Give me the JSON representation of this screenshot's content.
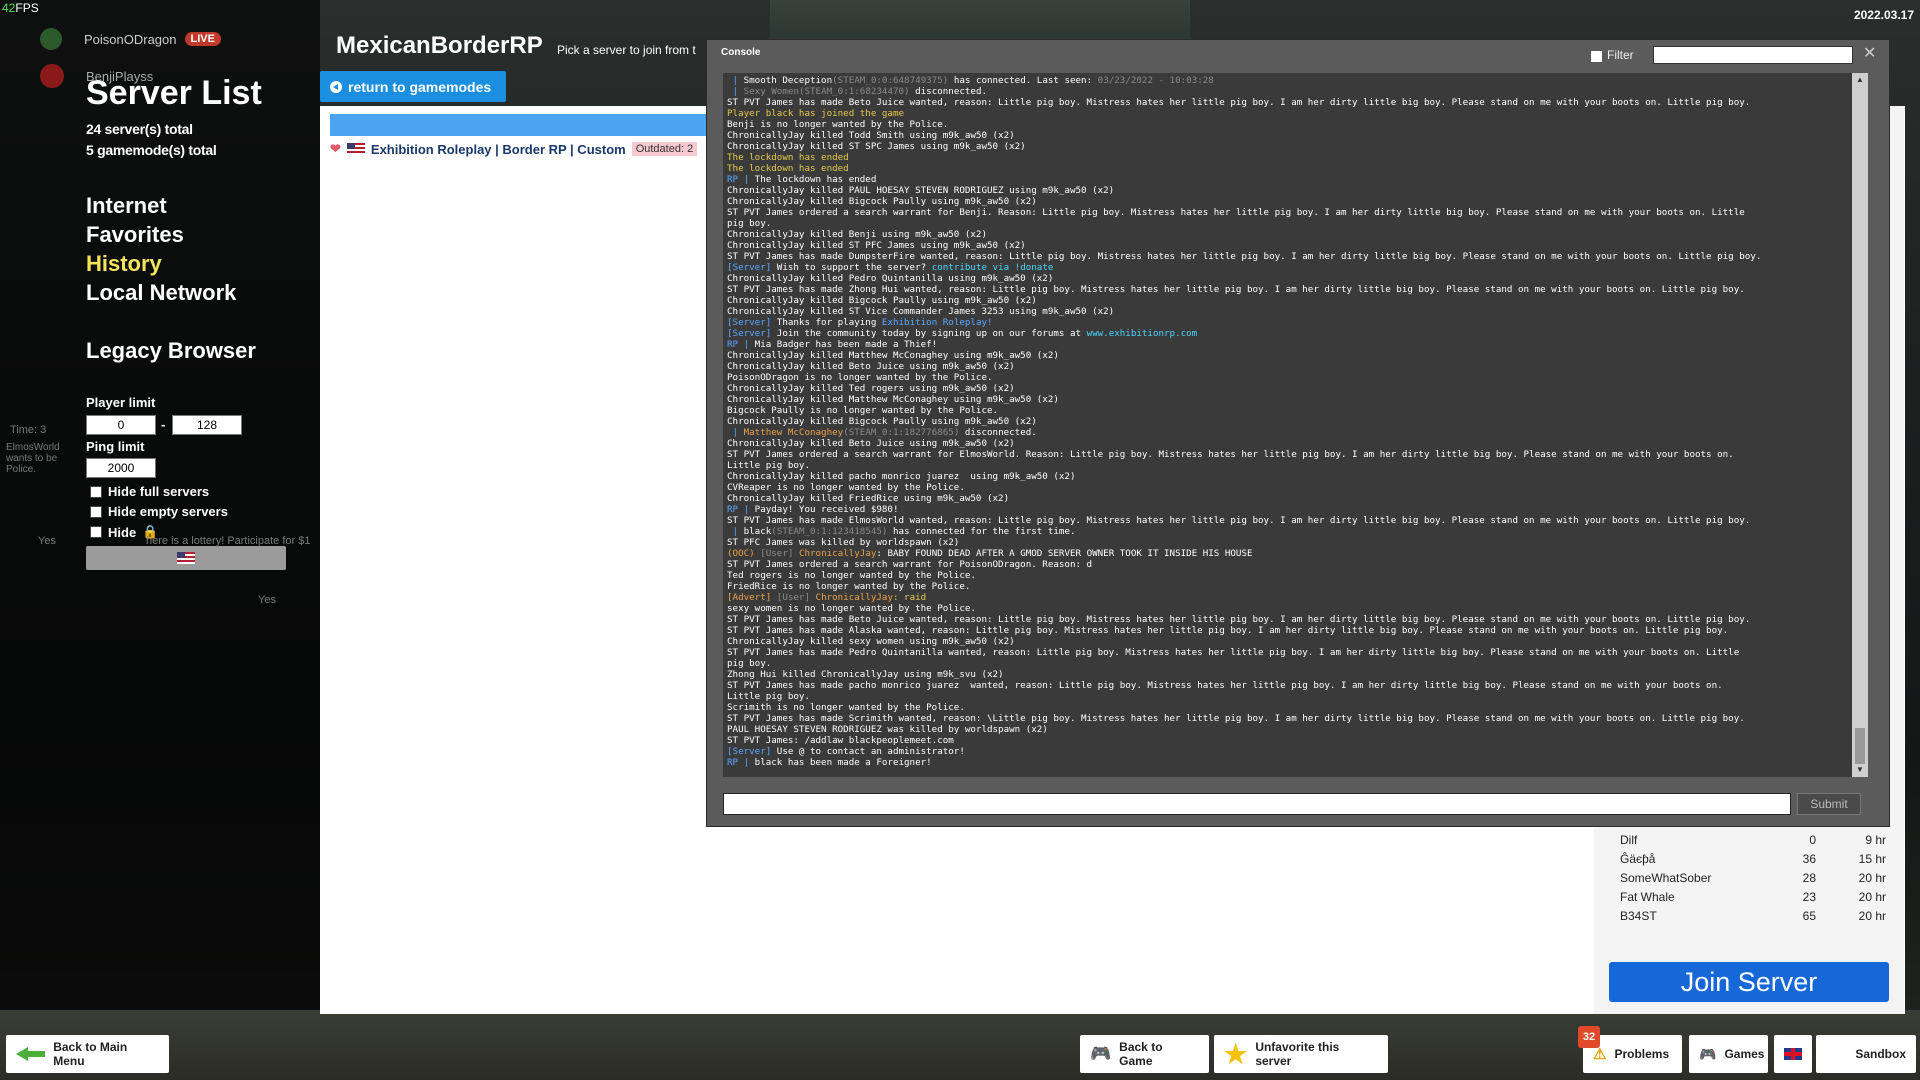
{
  "hud": {
    "fps": "42",
    "fps_unit": "FPS",
    "date": "2022.03.17"
  },
  "user": {
    "name": "PoisonODragon",
    "live": "LIVE",
    "secondary_name": "BenjiPlayss"
  },
  "sidebar": {
    "title": "Server List",
    "servers_total": "24 server(s) total",
    "gamemodes_total": "5 gamemode(s) total",
    "nav": [
      "Internet",
      "Favorites",
      "History",
      "Local Network"
    ],
    "legacy": "Legacy Browser",
    "player_limit_label": "Player limit",
    "player_min": "0",
    "player_sep": "-",
    "player_max": "128",
    "ping_limit_label": "Ping limit",
    "ping_value": "2000",
    "hide_full": "Hide full servers",
    "hide_empty": "Hide empty servers",
    "hide_locked": "Hide"
  },
  "background_text": {
    "elmos": "ElmosWorld wants to be Police.",
    "lottery": "here is a lottery! Participate for $1",
    "yes1": "Yes",
    "yes2": "Yes",
    "time": "Time: 3"
  },
  "header": {
    "gamemode": "MexicanBorderRP",
    "subtitle": "Pick a server to join from t",
    "return_label": "return to gamemodes"
  },
  "server": {
    "name": "Exhibition Roleplay | Border RP | Custom",
    "status": "Outdated: 2"
  },
  "players": [
    {
      "name": "Dilf",
      "score": "0",
      "time": "9 hr"
    },
    {
      "name": "Ĝäєƥå",
      "score": "36",
      "time": "15 hr"
    },
    {
      "name": "SomeWhatSober",
      "score": "28",
      "time": "20 hr"
    },
    {
      "name": "Fat Whale",
      "score": "23",
      "time": "20 hr"
    },
    {
      "name": "B34ST",
      "score": "65",
      "time": "20 hr"
    }
  ],
  "join_label": "Join Server",
  "console": {
    "title": "Console",
    "filter_label": "Filter",
    "submit_label": "Submit",
    "lines": [
      [
        [
          "b",
          " | "
        ],
        [
          "w",
          "Smooth Deception"
        ],
        [
          "g",
          "(STEAM_0:0:648749375)"
        ],
        [
          "w",
          " has connected. Last seen: "
        ],
        [
          "g",
          "03/23/2022 - 10:03:28"
        ]
      ],
      [
        [
          "b",
          " | "
        ],
        [
          "g",
          "Sexy Women"
        ],
        [
          "g",
          "(STEAM_0:1:68234470)"
        ],
        [
          "w",
          " disconnected."
        ]
      ],
      [
        [
          "w",
          "ST PVT James has made Beto Juice wanted, reason: Little pig boy. Mistress hates her little pig boy. I am her dirty little big boy. Please stand on me with your boots on. Little pig boy."
        ]
      ],
      [
        [
          "y",
          "Player black has joined the game"
        ]
      ],
      [
        [
          "w",
          "Benji is no longer wanted by the Police."
        ]
      ],
      [
        [
          "w",
          "ChronicallyJay killed Todd Smith using m9k_aw50 (x2)"
        ]
      ],
      [
        [
          "w",
          "ChronicallyJay killed ST SPC James using m9k_aw50 (x2)"
        ]
      ],
      [
        [
          "y",
          "The lockdown has ended"
        ]
      ],
      [
        [
          "y",
          "The lockdown has ended"
        ]
      ],
      [
        [
          "b",
          "RP | "
        ],
        [
          "w",
          "The lockdown has ended"
        ]
      ],
      [
        [
          "w",
          "ChronicallyJay killed PAUL HOESAY STEVEN RODRIGUEZ using m9k_aw50 (x2)"
        ]
      ],
      [
        [
          "w",
          "ChronicallyJay killed Bigcock Paully using m9k_aw50 (x2)"
        ]
      ],
      [
        [
          "w",
          "ST PVT James ordered a search warrant for Benji. Reason: Little pig boy. Mistress hates her little pig boy. I am her dirty little big boy. Please stand on me with your boots on. Little"
        ]
      ],
      [
        [
          "w",
          "pig boy."
        ]
      ],
      [
        [
          "w",
          "ChronicallyJay killed Benji using m9k_aw50 (x2)"
        ]
      ],
      [
        [
          "w",
          "ChronicallyJay killed ST PFC James using m9k_aw50 (x2)"
        ]
      ],
      [
        [
          "w",
          "ST PVT James has made DumpsterFire wanted, reason: Little pig boy. Mistress hates her little pig boy. I am her dirty little big boy. Please stand on me with your boots on. Little pig boy."
        ]
      ],
      [
        [
          "b",
          "[Server] "
        ],
        [
          "w",
          "Wish to support the server? "
        ],
        [
          "c",
          "contribute via !donate"
        ]
      ],
      [
        [
          "w",
          "ChronicallyJay killed Pedro Quintanilla using m9k_aw50 (x2)"
        ]
      ],
      [
        [
          "w",
          "ST PVT James has made Zhong Hui wanted, reason: Little pig boy. Mistress hates her little pig boy. I am her dirty little big boy. Please stand on me with your boots on. Little pig boy."
        ]
      ],
      [
        [
          "w",
          "ChronicallyJay killed Bigcock Paully using m9k_aw50 (x2)"
        ]
      ],
      [
        [
          "w",
          "ChronicallyJay killed ST Vice Commander James 3253 using m9k_aw50 (x2)"
        ]
      ],
      [
        [
          "b",
          "[Server] "
        ],
        [
          "w",
          "Thanks for playing "
        ],
        [
          "b",
          "Exhibition Roleplay!"
        ]
      ],
      [
        [
          "b",
          "[Server] "
        ],
        [
          "w",
          "Join the community today by signing up on our forums at "
        ],
        [
          "c",
          "www.exhibitionrp.com"
        ]
      ],
      [
        [
          "b",
          "RP | "
        ],
        [
          "w",
          "Mia Badger has been made a Thief!"
        ]
      ],
      [
        [
          "w",
          "ChronicallyJay killed Matthew McConaghey using m9k_aw50 (x2)"
        ]
      ],
      [
        [
          "w",
          "ChronicallyJay killed Beto Juice using m9k_aw50 (x2)"
        ]
      ],
      [
        [
          "w",
          "PoisonODragon is no longer wanted by the Police."
        ]
      ],
      [
        [
          "w",
          "ChronicallyJay killed Ted rogers using m9k_aw50 (x2)"
        ]
      ],
      [
        [
          "w",
          "ChronicallyJay killed Matthew McConaghey using m9k_aw50 (x2)"
        ]
      ],
      [
        [
          "w",
          "Bigcock Paully is no longer wanted by the Police."
        ]
      ],
      [
        [
          "w",
          "ChronicallyJay killed Bigcock Paully using m9k_aw50 (x2)"
        ]
      ],
      [
        [
          "b",
          " | "
        ],
        [
          "o",
          "Matthew McConaghey"
        ],
        [
          "g",
          "(STEAM_0:1:182776865)"
        ],
        [
          "w",
          " disconnected."
        ]
      ],
      [
        [
          "w",
          "ChronicallyJay killed Beto Juice using m9k_aw50 (x2)"
        ]
      ],
      [
        [
          "w",
          "ST PVT James ordered a search warrant for ElmosWorld. Reason: Little pig boy. Mistress hates her little pig boy. I am her dirty little big boy. Please stand on me with your boots on."
        ]
      ],
      [
        [
          "w",
          "Little pig boy."
        ]
      ],
      [
        [
          "w",
          "ChronicallyJay killed pacho monrico juarez  using m9k_aw50 (x2)"
        ]
      ],
      [
        [
          "w",
          "CVReaper is no longer wanted by the Police."
        ]
      ],
      [
        [
          "w",
          "ChronicallyJay killed FriedRice using m9k_aw50 (x2)"
        ]
      ],
      [
        [
          "b",
          "RP | "
        ],
        [
          "w",
          "Payday! You received $980!"
        ]
      ],
      [
        [
          "w",
          "ST PVT James has made ElmosWorld wanted, reason: Little pig boy. Mistress hates her little pig boy. I am her dirty little big boy. Please stand on me with your boots on. Little pig boy."
        ]
      ],
      [
        [
          "b",
          " | "
        ],
        [
          "w",
          "black"
        ],
        [
          "g",
          "(STEAM_0:1:123418545)"
        ],
        [
          "w",
          " has connected for the first time."
        ]
      ],
      [
        [
          "w",
          "ST PFC James was killed by worldspawn (x2)"
        ]
      ],
      [
        [
          "o",
          "(OOC) "
        ],
        [
          "g",
          "[User] "
        ],
        [
          "o",
          "ChronicallyJay"
        ],
        [
          "w",
          ": BABY FOUND DEAD AFTER A GMOD SERVER OWNER TOOK IT INSIDE HIS HOUSE"
        ]
      ],
      [
        [
          "w",
          "ST PVT James ordered a search warrant for PoisonODragon. Reason: d"
        ]
      ],
      [
        [
          "w",
          "Ted rogers is no longer wanted by the Police."
        ]
      ],
      [
        [
          "w",
          "FriedRice is no longer wanted by the Police."
        ]
      ],
      [
        [
          "o",
          "[Advert] "
        ],
        [
          "g",
          "[User] "
        ],
        [
          "o",
          "ChronicallyJay"
        ],
        [
          "y",
          ": raid"
        ]
      ],
      [
        [
          "w",
          "sexy women is no longer wanted by the Police."
        ]
      ],
      [
        [
          "w",
          "ST PVT James has made Beto Juice wanted, reason: Little pig boy. Mistress hates her little pig boy. I am her dirty little big boy. Please stand on me with your boots on. Little pig boy."
        ]
      ],
      [
        [
          "w",
          "ST PVT James has made Alaska wanted, reason: Little pig boy. Mistress hates her little pig boy. I am her dirty little big boy. Please stand on me with your boots on. Little pig boy."
        ]
      ],
      [
        [
          "w",
          "ChronicallyJay killed sexy women using m9k_aw50 (x2)"
        ]
      ],
      [
        [
          "w",
          "ST PVT James has made Pedro Quintanilla wanted, reason: Little pig boy. Mistress hates her little pig boy. I am her dirty little big boy. Please stand on me with your boots on. Little"
        ]
      ],
      [
        [
          "w",
          "pig boy."
        ]
      ],
      [
        [
          "w",
          "Zhong Hui killed ChronicallyJay using m9k_svu (x2)"
        ]
      ],
      [
        [
          "w",
          "ST PVT James has made pacho monrico juarez  wanted, reason: Little pig boy. Mistress hates her little pig boy. I am her dirty little big boy. Please stand on me with your boots on."
        ]
      ],
      [
        [
          "w",
          "Little pig boy."
        ]
      ],
      [
        [
          "w",
          "Scrimith is no longer wanted by the Police."
        ]
      ],
      [
        [
          "w",
          "ST PVT James has made Scrimith wanted, reason: \\Little pig boy. Mistress hates her little pig boy. I am her dirty little big boy. Please stand on me with your boots on. Little pig boy."
        ]
      ],
      [
        [
          "w",
          "PAUL HOESAY STEVEN RODRIGUEZ was killed by worldspawn (x2)"
        ]
      ],
      [
        [
          "w",
          "ST PVT James: /addlaw blackpeoplemeet.com"
        ]
      ],
      [
        [
          "b",
          "[Server] "
        ],
        [
          "w",
          "Use @ to contact an administrator!"
        ]
      ],
      [
        [
          "b",
          "RP | "
        ],
        [
          "w",
          "black has been made a Foreigner!"
        ]
      ]
    ]
  },
  "bottom": {
    "back_main": "Back to Main Menu",
    "back_game": "Back to Game",
    "unfavorite": "Unfavorite this server",
    "problems_count": "32",
    "problems": "Problems",
    "games": "Games",
    "sandbox": "Sandbox"
  }
}
